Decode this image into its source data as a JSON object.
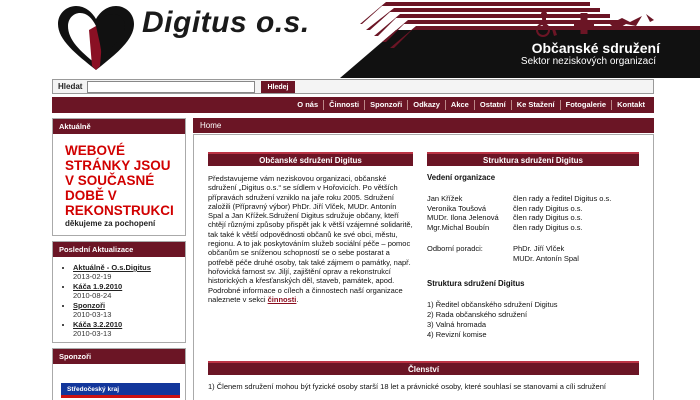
{
  "header": {
    "logo_text": "Digitus o.s.",
    "org_title": "Občanské sdružení",
    "org_subtitle": "Sektor neziskových organizací",
    "accent_color": "#6b1525"
  },
  "search": {
    "label": "Hledat",
    "value": "",
    "placeholder": "",
    "button_label": "Hledej"
  },
  "nav": {
    "items": [
      "O nás",
      "Činnosti",
      "Sponzoři",
      "Odkazy",
      "Akce",
      "Ostatní",
      "Ke Stažení",
      "Fotogalerie",
      "Kontakt"
    ]
  },
  "sidebar": {
    "news": {
      "title": "Aktuálně",
      "big_text": "WEBOVÉ STRÁNKY JSOU V SOUČASNÉ DOBĚ V REKONSTRUKCI",
      "small_text": "děkujeme za pochopení"
    },
    "latest": {
      "title": "Poslední Aktualizace",
      "items": [
        {
          "title": "Aktuálně - O.s.Digitus",
          "date": "2013-02-19"
        },
        {
          "title": "Káča 1.9.2010",
          "date": "2010-08-24"
        },
        {
          "title": "Sponzoři",
          "date": "2010-03-13"
        },
        {
          "title": "Káča 3.2.2010",
          "date": "2010-03-13"
        }
      ]
    },
    "sponsors": {
      "title": "Sponzoři",
      "banner_text": "Středočeský kraj"
    }
  },
  "breadcrumb": {
    "home": "Home"
  },
  "about": {
    "title": "Občanské sdružení Digitus",
    "text_before_link": "Představujeme vám neziskovou organizaci, občanské sdružení „Digitus o.s.“ se sídlem v Hořovicích. Po větších přípravách sdružení vzniklo na jaře roku 2005. Sdružení založili (Přípravný výbor) PhDr. Jiří Vlček, MUDr. Antonín Spal a Jan Křížek.Sdružení Digitus sdružuje občany, kteří chtějí různými způsoby přispět jak k větší vzájemné solidaritě, tak také k větší odpovědnosti občanů ke své obci, městu, regionu. A to jak poskytováním služeb sociální péče – pomoc občanům se sníženou schopností se o sebe postarat a potřebě péče druhé osoby, tak také zájmem o památky, např. hořovická farnost sv. Jiljí, zajištění oprav a rekonstrukcí historických a křesťanských děl, staveb, památek, apod. Podrobné informace o cílech a činnostech naší organizace naleznete v sekci ",
    "link_text": "činnosti",
    "text_after_link": "."
  },
  "structure": {
    "title": "Struktura sdružení Digitus",
    "management_title": "Vedení organizace",
    "members": [
      {
        "name": "Jan Křížek",
        "role": "člen rady a ředitel Digitus o.s."
      },
      {
        "name": "Veronika Toušová",
        "role": "člen rady Digitus o.s."
      },
      {
        "name": "MUDr. Ilona Jelenová",
        "role": "člen rady Digitus o.s."
      },
      {
        "name": "Mgr.Michal Boubín",
        "role": "člen rady Digitus o.s."
      }
    ],
    "advisors_label": "Odborní poradci:",
    "advisors": [
      "PhDr. Jiří Vlček",
      "MUDr. Antonín Spal"
    ],
    "structure_title": "Struktura sdružení Digitus",
    "structure_items": [
      "1) Ředitel občanského sdružení Digitus",
      "2) Rada občanského sdružení",
      "3) Valná hromada",
      "4) Revizní komise"
    ]
  },
  "membership": {
    "title": "Členství",
    "text": "1) Členem sdružení mohou být fyzické osoby starší 18 let a právnické osoby, které souhlasí se stanovami a cíli sdružení"
  }
}
